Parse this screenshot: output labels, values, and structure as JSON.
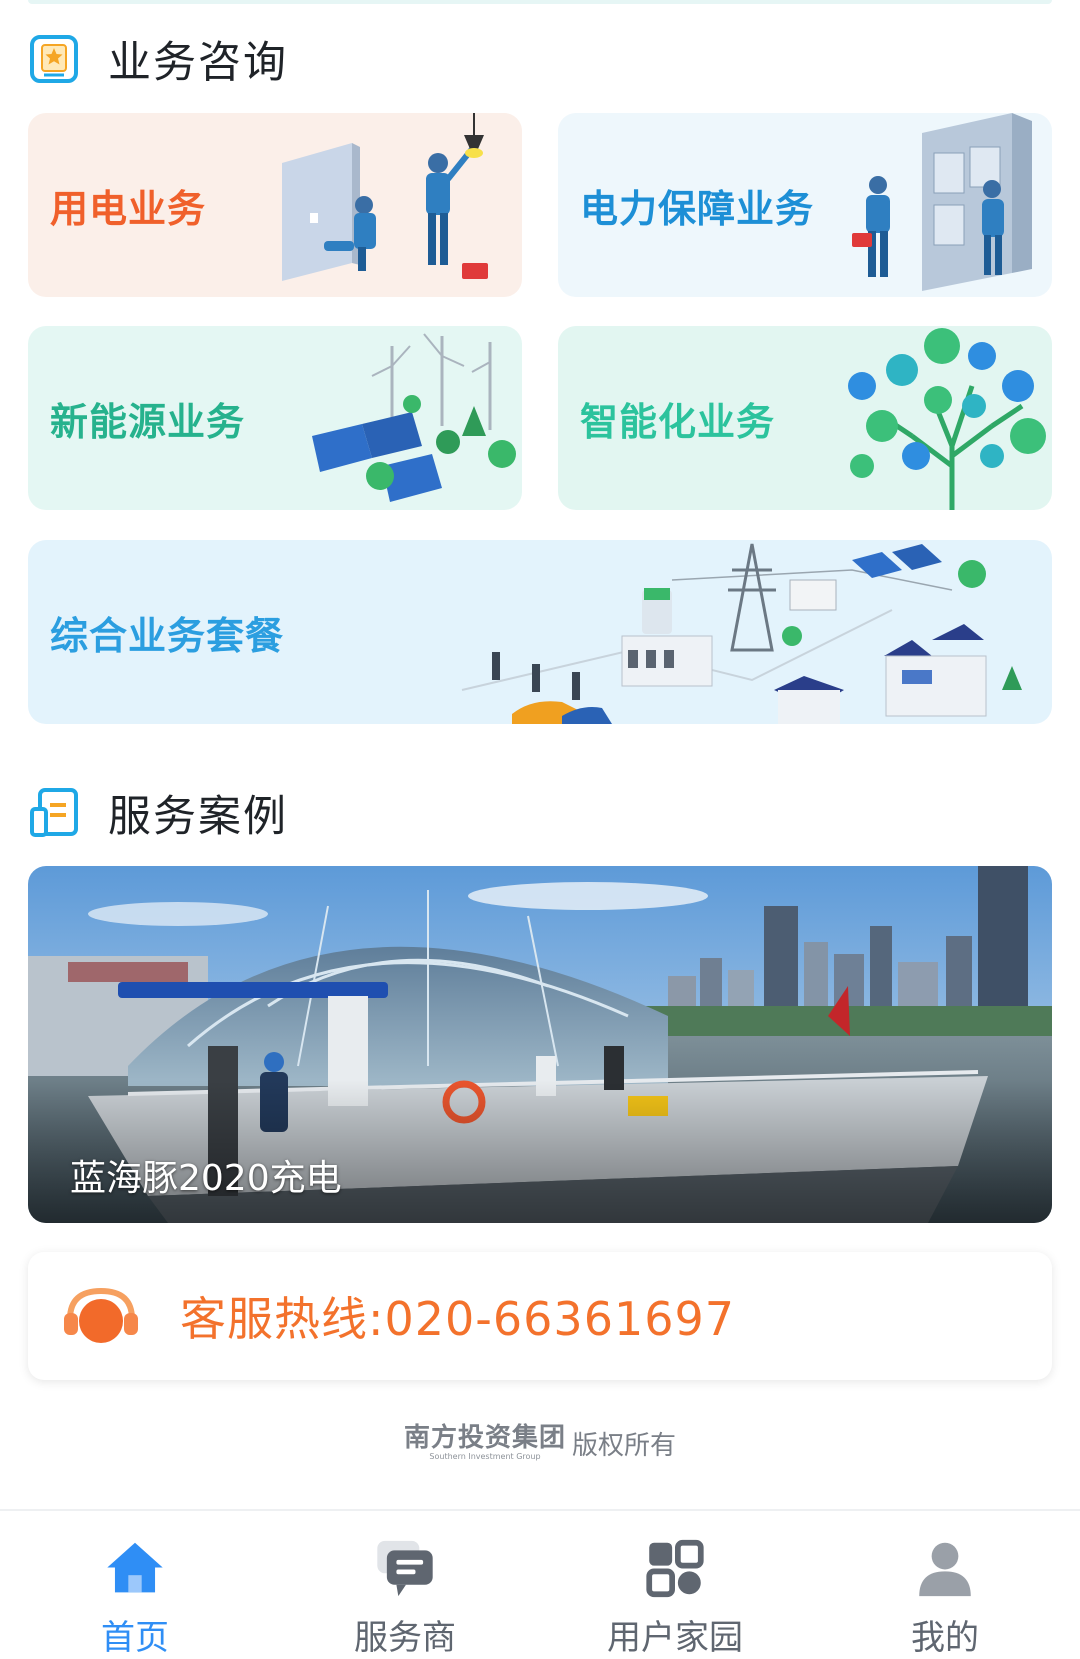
{
  "consult": {
    "title": "业务咨询",
    "cards": [
      {
        "label": "用电业务"
      },
      {
        "label": "电力保障业务"
      },
      {
        "label": "新能源业务"
      },
      {
        "label": "智能化业务"
      },
      {
        "label": "综合业务套餐"
      }
    ]
  },
  "cases": {
    "title": "服务案例",
    "items": [
      {
        "caption": "蓝海豚2020充电"
      }
    ]
  },
  "hotline": {
    "text": "客服热线:020-66361697"
  },
  "footer": {
    "logo_cn": "南方投资集团",
    "logo_en": "Southern Investment Group",
    "rights": "版权所有"
  },
  "tabbar": {
    "items": [
      {
        "label": "首页",
        "icon": "home-icon",
        "active": true
      },
      {
        "label": "服务商",
        "icon": "chat-icon",
        "active": false
      },
      {
        "label": "用户家园",
        "icon": "apps-icon",
        "active": false
      },
      {
        "label": "我的",
        "icon": "user-icon",
        "active": false
      }
    ]
  },
  "colors": {
    "accent": "#2f8ef5",
    "hotline": "#f3722c",
    "electric_label": "#f0602b",
    "power_label": "#1d8fd6",
    "newenergy_label": "#26b28d",
    "smart_label": "#2cc39d",
    "package_label": "#2b9ee0"
  }
}
